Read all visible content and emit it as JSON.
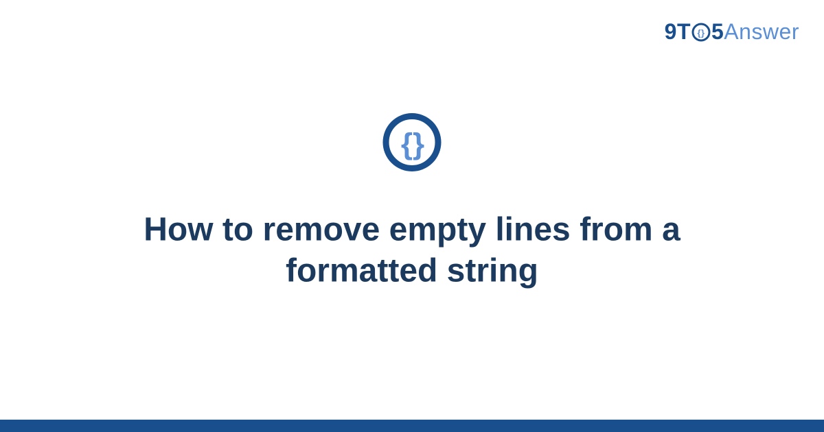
{
  "logo": {
    "part1": "9T",
    "part2": "5",
    "part3": "Answer"
  },
  "icon": {
    "name": "curly-braces-icon",
    "glyph_left": "{",
    "glyph_right": "}",
    "colors": {
      "ring": "#1a4f8e",
      "brace": "#5a8fd6"
    }
  },
  "title": "How to remove empty lines from a formatted string",
  "colors": {
    "bottom_bar": "#1a4f8e"
  }
}
